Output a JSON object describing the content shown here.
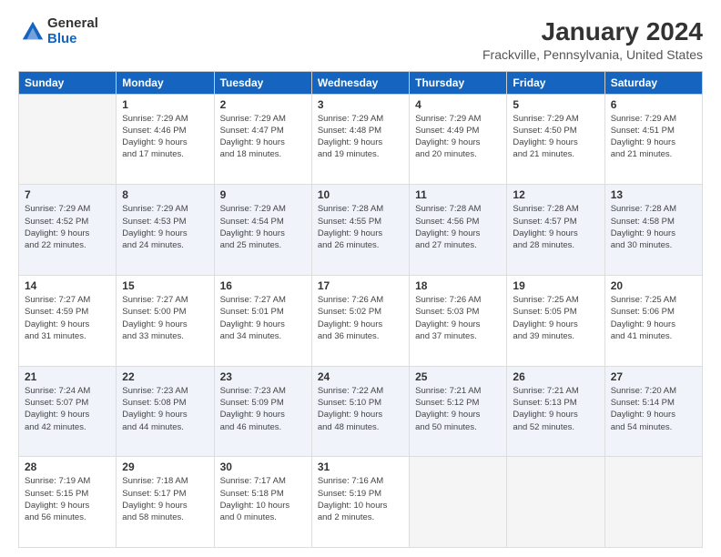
{
  "logo": {
    "general": "General",
    "blue": "Blue"
  },
  "header": {
    "title": "January 2024",
    "subtitle": "Frackville, Pennsylvania, United States"
  },
  "weekdays": [
    "Sunday",
    "Monday",
    "Tuesday",
    "Wednesday",
    "Thursday",
    "Friday",
    "Saturday"
  ],
  "weeks": [
    [
      {
        "day": "",
        "info": ""
      },
      {
        "day": "1",
        "info": "Sunrise: 7:29 AM\nSunset: 4:46 PM\nDaylight: 9 hours\nand 17 minutes."
      },
      {
        "day": "2",
        "info": "Sunrise: 7:29 AM\nSunset: 4:47 PM\nDaylight: 9 hours\nand 18 minutes."
      },
      {
        "day": "3",
        "info": "Sunrise: 7:29 AM\nSunset: 4:48 PM\nDaylight: 9 hours\nand 19 minutes."
      },
      {
        "day": "4",
        "info": "Sunrise: 7:29 AM\nSunset: 4:49 PM\nDaylight: 9 hours\nand 20 minutes."
      },
      {
        "day": "5",
        "info": "Sunrise: 7:29 AM\nSunset: 4:50 PM\nDaylight: 9 hours\nand 21 minutes."
      },
      {
        "day": "6",
        "info": "Sunrise: 7:29 AM\nSunset: 4:51 PM\nDaylight: 9 hours\nand 21 minutes."
      }
    ],
    [
      {
        "day": "7",
        "info": "Sunrise: 7:29 AM\nSunset: 4:52 PM\nDaylight: 9 hours\nand 22 minutes."
      },
      {
        "day": "8",
        "info": "Sunrise: 7:29 AM\nSunset: 4:53 PM\nDaylight: 9 hours\nand 24 minutes."
      },
      {
        "day": "9",
        "info": "Sunrise: 7:29 AM\nSunset: 4:54 PM\nDaylight: 9 hours\nand 25 minutes."
      },
      {
        "day": "10",
        "info": "Sunrise: 7:28 AM\nSunset: 4:55 PM\nDaylight: 9 hours\nand 26 minutes."
      },
      {
        "day": "11",
        "info": "Sunrise: 7:28 AM\nSunset: 4:56 PM\nDaylight: 9 hours\nand 27 minutes."
      },
      {
        "day": "12",
        "info": "Sunrise: 7:28 AM\nSunset: 4:57 PM\nDaylight: 9 hours\nand 28 minutes."
      },
      {
        "day": "13",
        "info": "Sunrise: 7:28 AM\nSunset: 4:58 PM\nDaylight: 9 hours\nand 30 minutes."
      }
    ],
    [
      {
        "day": "14",
        "info": "Sunrise: 7:27 AM\nSunset: 4:59 PM\nDaylight: 9 hours\nand 31 minutes."
      },
      {
        "day": "15",
        "info": "Sunrise: 7:27 AM\nSunset: 5:00 PM\nDaylight: 9 hours\nand 33 minutes."
      },
      {
        "day": "16",
        "info": "Sunrise: 7:27 AM\nSunset: 5:01 PM\nDaylight: 9 hours\nand 34 minutes."
      },
      {
        "day": "17",
        "info": "Sunrise: 7:26 AM\nSunset: 5:02 PM\nDaylight: 9 hours\nand 36 minutes."
      },
      {
        "day": "18",
        "info": "Sunrise: 7:26 AM\nSunset: 5:03 PM\nDaylight: 9 hours\nand 37 minutes."
      },
      {
        "day": "19",
        "info": "Sunrise: 7:25 AM\nSunset: 5:05 PM\nDaylight: 9 hours\nand 39 minutes."
      },
      {
        "day": "20",
        "info": "Sunrise: 7:25 AM\nSunset: 5:06 PM\nDaylight: 9 hours\nand 41 minutes."
      }
    ],
    [
      {
        "day": "21",
        "info": "Sunrise: 7:24 AM\nSunset: 5:07 PM\nDaylight: 9 hours\nand 42 minutes."
      },
      {
        "day": "22",
        "info": "Sunrise: 7:23 AM\nSunset: 5:08 PM\nDaylight: 9 hours\nand 44 minutes."
      },
      {
        "day": "23",
        "info": "Sunrise: 7:23 AM\nSunset: 5:09 PM\nDaylight: 9 hours\nand 46 minutes."
      },
      {
        "day": "24",
        "info": "Sunrise: 7:22 AM\nSunset: 5:10 PM\nDaylight: 9 hours\nand 48 minutes."
      },
      {
        "day": "25",
        "info": "Sunrise: 7:21 AM\nSunset: 5:12 PM\nDaylight: 9 hours\nand 50 minutes."
      },
      {
        "day": "26",
        "info": "Sunrise: 7:21 AM\nSunset: 5:13 PM\nDaylight: 9 hours\nand 52 minutes."
      },
      {
        "day": "27",
        "info": "Sunrise: 7:20 AM\nSunset: 5:14 PM\nDaylight: 9 hours\nand 54 minutes."
      }
    ],
    [
      {
        "day": "28",
        "info": "Sunrise: 7:19 AM\nSunset: 5:15 PM\nDaylight: 9 hours\nand 56 minutes."
      },
      {
        "day": "29",
        "info": "Sunrise: 7:18 AM\nSunset: 5:17 PM\nDaylight: 9 hours\nand 58 minutes."
      },
      {
        "day": "30",
        "info": "Sunrise: 7:17 AM\nSunset: 5:18 PM\nDaylight: 10 hours\nand 0 minutes."
      },
      {
        "day": "31",
        "info": "Sunrise: 7:16 AM\nSunset: 5:19 PM\nDaylight: 10 hours\nand 2 minutes."
      },
      {
        "day": "",
        "info": ""
      },
      {
        "day": "",
        "info": ""
      },
      {
        "day": "",
        "info": ""
      }
    ]
  ]
}
